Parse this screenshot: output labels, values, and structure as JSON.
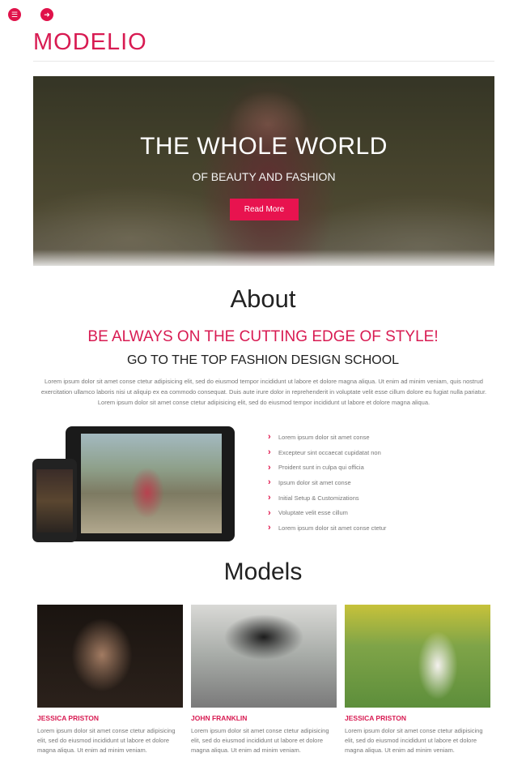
{
  "header": {
    "logo": "MODELIO",
    "menu_icon": "hamburger-icon",
    "arrow_icon": "arrow-right-icon"
  },
  "hero": {
    "title": "THE WHOLE WORLD",
    "subtitle": "OF BEAUTY AND FASHION",
    "button_label": "Read More"
  },
  "about": {
    "heading": "About",
    "tagline": "BE ALWAYS ON THE CUTTING EDGE OF STYLE!",
    "subheading": "GO TO THE TOP FASHION DESIGN SCHOOL",
    "paragraph": "Lorem ipsum dolor sit amet conse ctetur adipisicing elit, sed do eiusmod tempor incididunt ut labore et dolore magna aliqua. Ut enim ad minim veniam, quis nostrud exercitation ullamco laboris nisi ut aliquip ex ea commodo consequat. Duis aute irure dolor in reprehenderit in voluptate velit esse cillum dolore eu fugiat nulla pariatur. Lorem ipsum dolor sit amet conse ctetur adipisicing elit, sed do eiusmod tempor incididunt ut labore et dolore magna aliqua.",
    "features": [
      "Lorem ipsum dolor sit amet conse",
      "Excepteur sint occaecat cupidatat non",
      "Proident sunt in culpa qui officia",
      "Ipsum dolor sit amet conse",
      "Initial Setup & Customizations",
      "Voluptate velit esse cillum",
      "Lorem ipsum dolor sit amet conse ctetur"
    ]
  },
  "models": {
    "heading": "Models",
    "items": [
      {
        "name": "JESSICA PRISTON",
        "desc": "Lorem ipsum dolor sit amet conse ctetur adipisicing elit, sed do eiusmod incididunt ut labore et dolore magna aliqua. Ut enim ad minim veniam."
      },
      {
        "name": "JOHN FRANKLIN",
        "desc": "Lorem ipsum dolor sit amet conse ctetur adipisicing elit, sed do eiusmod incididunt ut labore et dolore magna aliqua. Ut enim ad minim veniam."
      },
      {
        "name": "JESSICA PRISTON",
        "desc": "Lorem ipsum dolor sit amet conse ctetur adipisicing elit, sed do eiusmod incididunt ut labore et dolore magna aliqua. Ut enim ad minim veniam."
      }
    ]
  },
  "colors": {
    "accent": "#d81b52",
    "button": "#e8134f"
  }
}
